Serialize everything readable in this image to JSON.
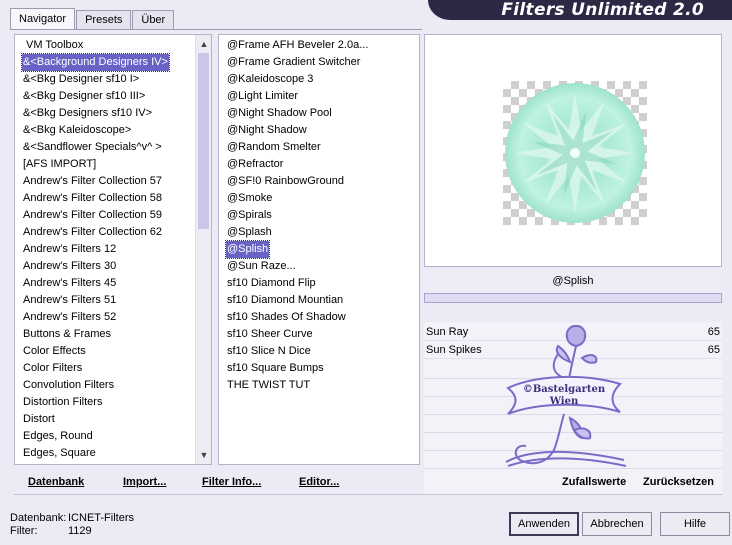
{
  "window": {
    "title": "Filters Unlimited 2.0"
  },
  "tabs": [
    {
      "label": "Navigator"
    },
    {
      "label": "Presets"
    },
    {
      "label": "Über"
    }
  ],
  "categories": {
    "items": [
      "VM Toolbox",
      "&<Background Designers IV>",
      "&<Bkg Designer sf10 I>",
      "&<Bkg Designer sf10 III>",
      "&<Bkg Designers sf10 IV>",
      "&<Bkg Kaleidoscope>",
      "&<Sandflower Specials^v^ >",
      "[AFS IMPORT]",
      "Andrew's Filter Collection 57",
      "Andrew's Filter Collection 58",
      "Andrew's Filter Collection 59",
      "Andrew's Filter Collection 62",
      "Andrew's Filters 12",
      "Andrew's Filters 30",
      "Andrew's Filters 45",
      "Andrew's Filters 51",
      "Andrew's Filters 52",
      "Buttons & Frames",
      "Color Effects",
      "Color Filters",
      "Convolution Filters",
      "Distortion Filters",
      "Distort",
      "Edges, Round",
      "Edges, Square"
    ],
    "selected_index": 1
  },
  "filters": {
    "items": [
      "@Frame AFH Beveler 2.0a...",
      "@Frame Gradient Switcher",
      "@Kaleidoscope 3",
      "@Light Limiter",
      "@Night Shadow Pool",
      "@Night Shadow",
      "@Random Smelter",
      "@Refractor",
      "@SF!0 RainbowGround",
      "@Smoke",
      "@Spirals",
      "@Splash",
      "@Splish",
      "@Sun Raze...",
      "sf10 Diamond Flip",
      "sf10 Diamond Mountian",
      "sf10 Shades Of Shadow",
      "sf10 Sheer Curve",
      "sf10 Slice N Dice",
      "sf10 Square Bumps",
      "THE TWIST TUT"
    ],
    "selected_index": 12
  },
  "preview": {
    "current_filter": "@Splish"
  },
  "params": [
    {
      "name": "Sun Ray",
      "value": "65"
    },
    {
      "name": "Sun Spikes",
      "value": "65"
    }
  ],
  "watermark": {
    "line1": "©Bastelgarten",
    "line2": "Wien"
  },
  "links": {
    "database": "Datenbank",
    "import": "Import...",
    "filter_info": "Filter Info...",
    "editor": "Editor...",
    "random": "Zufallswerte",
    "reset": "Zurücksetzen"
  },
  "info": {
    "db_label": "Datenbank:",
    "db_value": "ICNET-Filters",
    "filter_label": "Filter:",
    "filter_value": "1129"
  },
  "buttons": {
    "apply": "Anwenden",
    "cancel": "Abbrechen",
    "help": "Hilfe"
  },
  "colors": {
    "accent": "#6a63c6",
    "banner": "#2b2944",
    "preview_fill": "#b6ecd8",
    "stamp": "#7a6bc8"
  }
}
